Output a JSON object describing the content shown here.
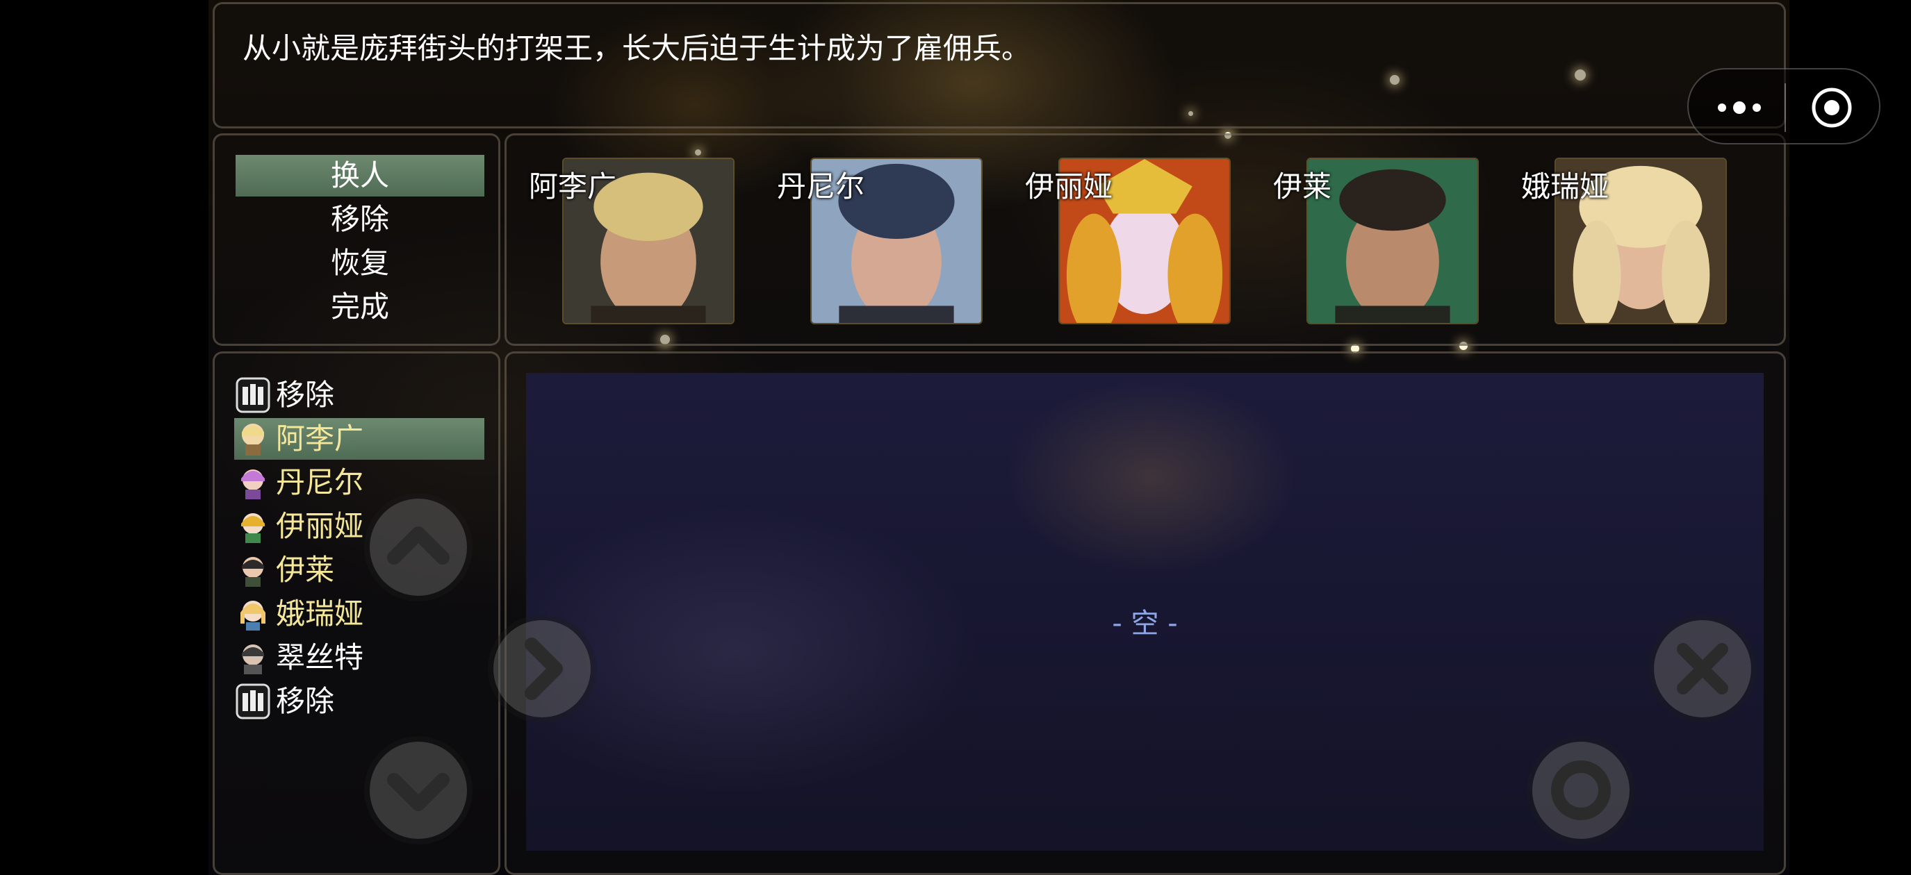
{
  "help": {
    "text": "从小就是庞拜街头的打架王，长大后迫于生计成为了雇佣兵。"
  },
  "commands": [
    {
      "label": "换人",
      "selected": true
    },
    {
      "label": "移除",
      "selected": false
    },
    {
      "label": "恢复",
      "selected": false
    },
    {
      "label": "完成",
      "selected": false
    }
  ],
  "party": [
    {
      "name": "阿李广",
      "icon": "blonde-warrior-portrait"
    },
    {
      "name": "丹尼尔",
      "icon": "dark-hair-man-portrait"
    },
    {
      "name": "伊丽娅",
      "icon": "golden-crown-woman-portrait"
    },
    {
      "name": "伊莱",
      "icon": "smiling-man-portrait"
    },
    {
      "name": "娥瑞娅",
      "icon": "blonde-woman-portrait"
    }
  ],
  "member_list": [
    {
      "label": "移除",
      "icon": "remove-icon",
      "highlight": false,
      "selected": false
    },
    {
      "label": "阿李广",
      "icon": "chibi-blonde-icon",
      "highlight": true,
      "selected": true
    },
    {
      "label": "丹尼尔",
      "icon": "chibi-purple-hair-icon",
      "highlight": true,
      "selected": false
    },
    {
      "label": "伊丽娅",
      "icon": "chibi-crown-icon",
      "highlight": true,
      "selected": false
    },
    {
      "label": "伊莱",
      "icon": "chibi-dark-hair-icon",
      "highlight": true,
      "selected": false
    },
    {
      "label": "娥瑞娅",
      "icon": "chibi-blonde-girl-icon",
      "highlight": true,
      "selected": false
    },
    {
      "label": "翠丝特",
      "icon": "chibi-armor-icon",
      "highlight": false,
      "selected": false
    },
    {
      "label": "移除",
      "icon": "remove-icon",
      "highlight": false,
      "selected": false
    }
  ],
  "status": {
    "empty_text": "- 空 -"
  },
  "colors": {
    "selection": "#5d7a62",
    "member_name": "#f4e79a",
    "empty_text": "#8fa6e6"
  }
}
